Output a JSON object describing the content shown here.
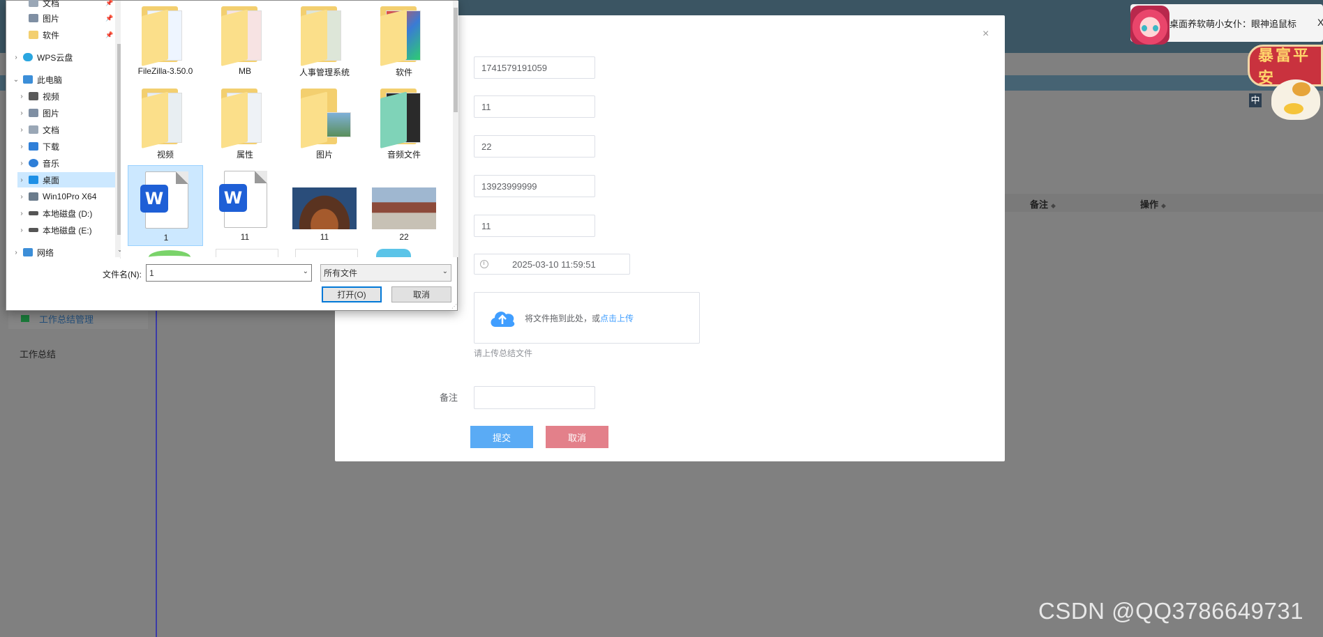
{
  "background_page": {
    "sidebar_menu_item": "工作总结管理",
    "sidebar_section_title": "工作总结",
    "table_headers": [
      {
        "label": "备注",
        "sort_icon": "sort-icon"
      },
      {
        "label": "操作",
        "sort_icon": "sort-icon"
      }
    ],
    "watermark": "CSDN @QQ3786649731"
  },
  "mascot": {
    "banner_text": "桌面养软萌小女仆：眼神追鼠标",
    "close_label": "X",
    "sign_text": "暴富平安",
    "ime_label": "中"
  },
  "form_dialog": {
    "close_label": "×",
    "fields": [
      {
        "value": "1741579191059"
      },
      {
        "value": "11"
      },
      {
        "value": "22"
      },
      {
        "value": "13923999999"
      },
      {
        "value": "11"
      }
    ],
    "date_value": "2025-03-10 11:59:51",
    "upload_text": "将文件拖到此处，或",
    "upload_link": "点击上传",
    "upload_tip": "请上传总结文件",
    "remark_label": "备注",
    "remark_value": "",
    "submit_label": "提交",
    "cancel_label": "取消"
  },
  "file_dialog": {
    "nav_items": [
      {
        "label": "文档",
        "icon": "document-icon",
        "pinned": true
      },
      {
        "label": "图片",
        "icon": "picture-icon",
        "pinned": true
      },
      {
        "label": "软件",
        "icon": "folder-icon",
        "pinned": true
      },
      {
        "label": "WPS云盘",
        "icon": "cloud-icon",
        "expandable": true
      },
      {
        "label": "此电脑",
        "icon": "computer-icon",
        "expanded": true
      },
      {
        "label": "视频",
        "icon": "video-icon",
        "expandable": true
      },
      {
        "label": "图片",
        "icon": "picture-icon",
        "expandable": true
      },
      {
        "label": "文档",
        "icon": "document-icon",
        "expandable": true
      },
      {
        "label": "下载",
        "icon": "download-icon",
        "expandable": true
      },
      {
        "label": "音乐",
        "icon": "music-icon",
        "expandable": true
      },
      {
        "label": "桌面",
        "icon": "desktop-icon",
        "expandable": true,
        "selected": true
      },
      {
        "label": "Win10Pro X64",
        "icon": "drive-icon",
        "expandable": true
      },
      {
        "label": "本地磁盘 (D:)",
        "icon": "drive-icon",
        "expandable": true
      },
      {
        "label": "本地磁盘 (E:)",
        "icon": "drive-icon",
        "expandable": true
      },
      {
        "label": "网络",
        "icon": "network-icon",
        "expandable": true
      }
    ],
    "files": [
      {
        "name": "FileZilla-3.50.0",
        "kind": "folder"
      },
      {
        "name": "MB",
        "kind": "folder"
      },
      {
        "name": "人事管理系统",
        "kind": "folder"
      },
      {
        "name": "软件",
        "kind": "folder"
      },
      {
        "name": "视频",
        "kind": "folder"
      },
      {
        "name": "属性",
        "kind": "folder"
      },
      {
        "name": "图片",
        "kind": "folder"
      },
      {
        "name": "音频文件",
        "kind": "folder"
      },
      {
        "name": "1",
        "kind": "word",
        "selected": true
      },
      {
        "name": "11",
        "kind": "word"
      },
      {
        "name": "11",
        "kind": "photo"
      },
      {
        "name": "22",
        "kind": "photo"
      }
    ],
    "filename_label": "文件名(N):",
    "filename_value": "1",
    "filetype_value": "所有文件",
    "open_label": "打开(O)",
    "cancel_label": "取消"
  }
}
